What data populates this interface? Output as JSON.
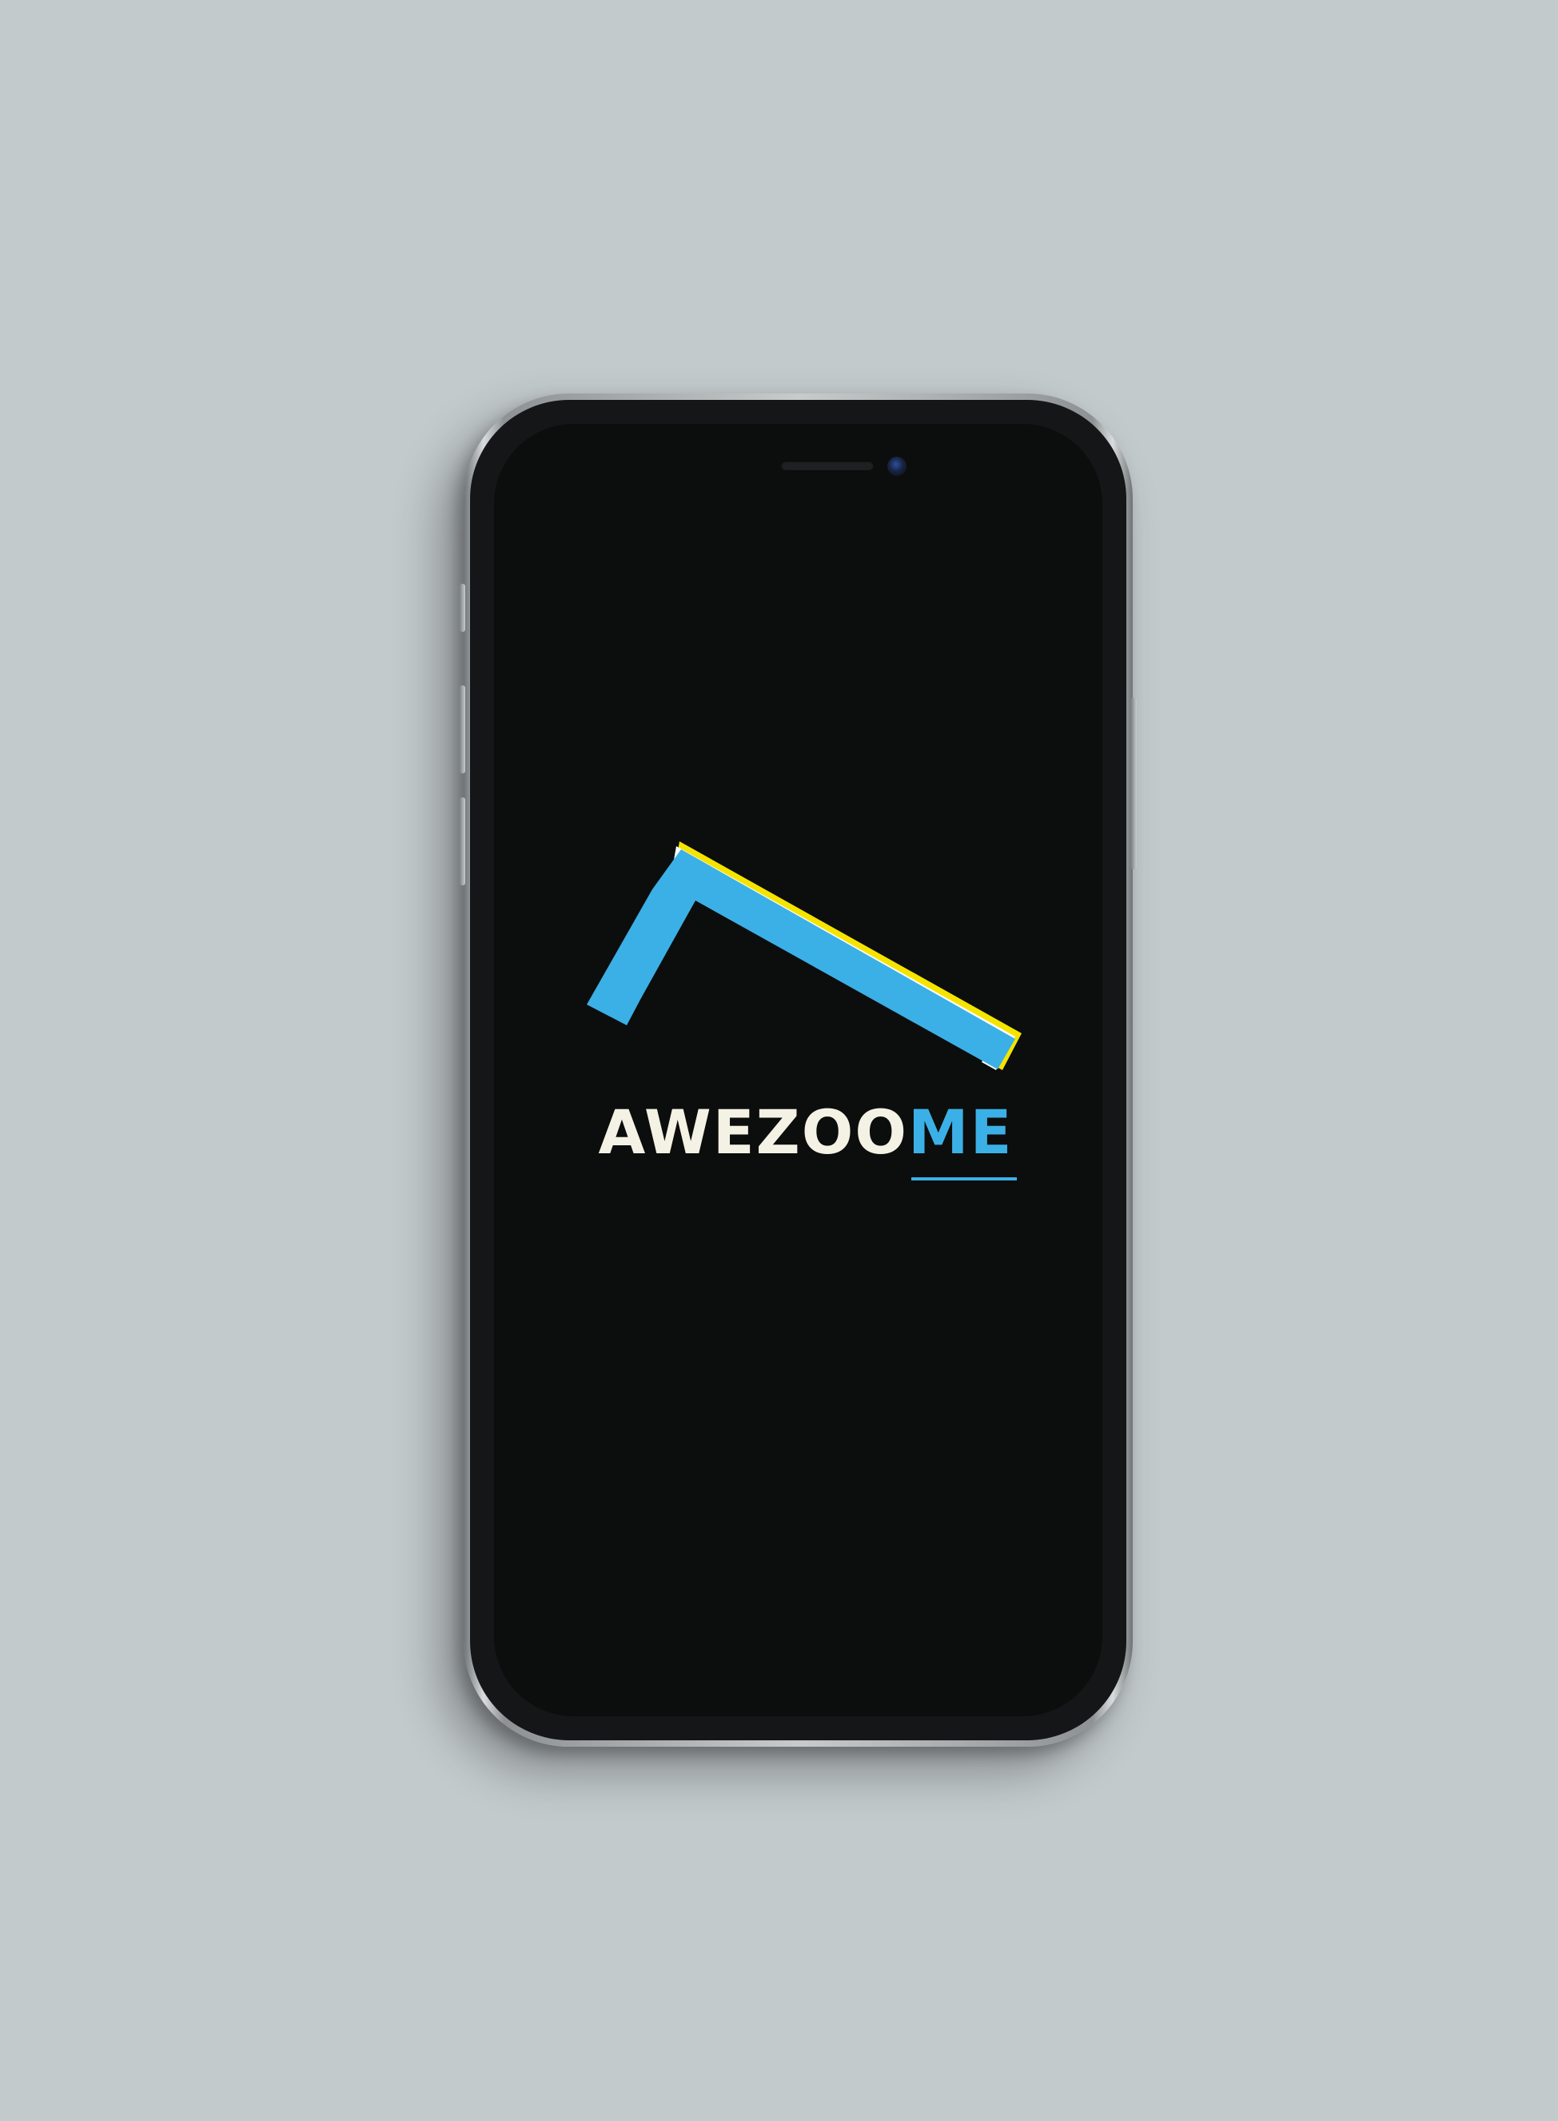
{
  "brand": {
    "name_part1": "AWEZOO",
    "name_part2": "ME",
    "colors": {
      "primary_blue": "#3bb0e6",
      "accent_yellow": "#f5e400",
      "wordmark_white": "#f4f2e4",
      "screen_black": "#0c0d0d",
      "background_gray": "#c3cacc"
    }
  },
  "device": {
    "type": "smartphone",
    "screen": "splash-screen"
  }
}
